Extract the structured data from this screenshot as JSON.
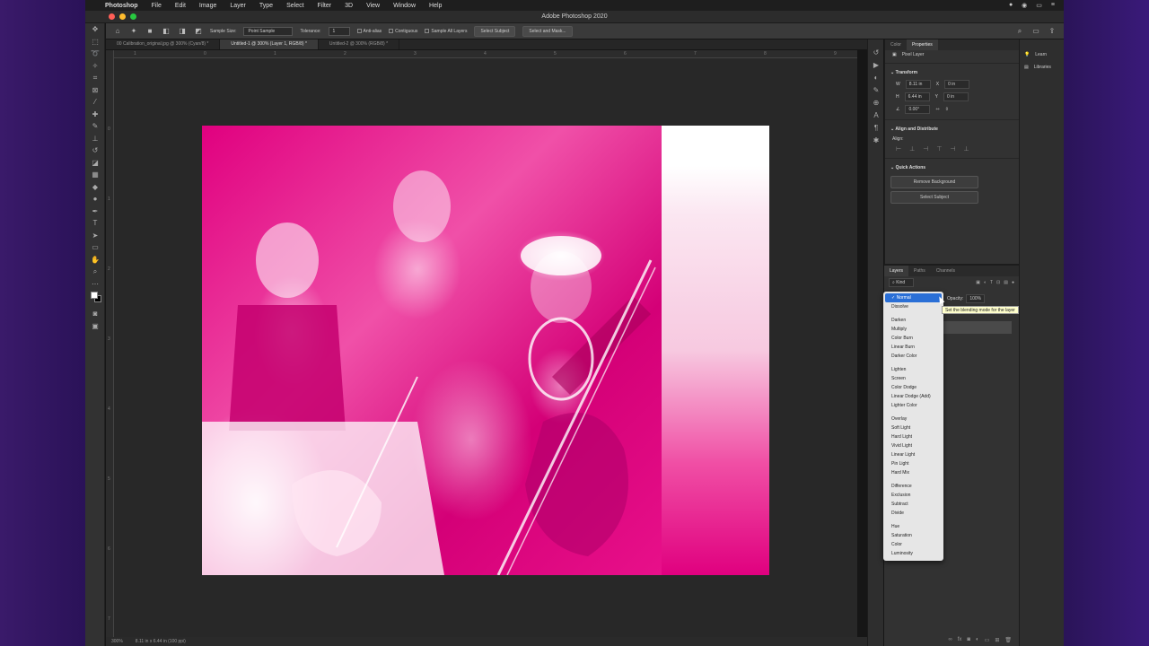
{
  "menubar": {
    "app": "Photoshop",
    "items": [
      "File",
      "Edit",
      "Image",
      "Layer",
      "Type",
      "Select",
      "Filter",
      "3D",
      "View",
      "Window",
      "Help"
    ]
  },
  "titlebar": {
    "title": "Adobe Photoshop 2020"
  },
  "options": {
    "sample_size_label": "Sample Size:",
    "sample_size_value": "Point Sample",
    "tolerance_label": "Tolerance:",
    "tolerance_value": "1",
    "anti_alias": "Anti-alias",
    "contiguous": "Contiguous",
    "sample_all": "Sample All Layers",
    "select_subject": "Select Subject",
    "select_mask": "Select and Mask..."
  },
  "tabs": [
    {
      "label": "00 Calibration_original.jpg @ 300% (Cyan/8) *"
    },
    {
      "label": "Untitled-1 @ 300% (Layer 1, RGB/8) *"
    },
    {
      "label": "Untitled-2 @ 300% (RGB/8) *"
    }
  ],
  "rulers": {
    "top": [
      "1",
      "0",
      "1",
      "2",
      "3",
      "4",
      "5",
      "6",
      "7",
      "8",
      "9"
    ],
    "left": [
      "0",
      "1",
      "2",
      "3",
      "4",
      "5",
      "6",
      "7"
    ]
  },
  "statusbar": {
    "zoom": "300%",
    "info": "8.11 in x 6.44 in (100 ppi)"
  },
  "properties": {
    "tabs": [
      "Color",
      "Properties"
    ],
    "layer_type": "Pixel Layer",
    "transform_title": "Transform",
    "w_label": "W",
    "w_value": "8.11 in",
    "x_label": "X",
    "x_value": "0 in",
    "h_label": "H",
    "h_value": "6.44 in",
    "y_label": "Y",
    "y_value": "0 in",
    "angle_value": "0.00°",
    "align_title": "Align and Distribute",
    "align_label": "Align:",
    "quick_title": "Quick Actions",
    "remove_bg": "Remove Background",
    "select_subject": "Select Subject"
  },
  "layers": {
    "tabs": [
      "Layers",
      "Paths",
      "Channels"
    ],
    "kind": "Kind",
    "opacity_label": "Opacity:",
    "opacity_value": "100%"
  },
  "dock2": {
    "learn": "Learn",
    "libraries": "Libraries"
  },
  "blend_modes": [
    [
      "Normal",
      "Dissolve"
    ],
    [
      "Darken",
      "Multiply",
      "Color Burn",
      "Linear Burn",
      "Darker Color"
    ],
    [
      "Lighten",
      "Screen",
      "Color Dodge",
      "Linear Dodge (Add)",
      "Lighter Color"
    ],
    [
      "Overlay",
      "Soft Light",
      "Hard Light",
      "Vivid Light",
      "Linear Light",
      "Pin Light",
      "Hard Mix"
    ],
    [
      "Difference",
      "Exclusion",
      "Subtract",
      "Divide"
    ],
    [
      "Hue",
      "Saturation",
      "Color",
      "Luminosity"
    ]
  ],
  "tooltip": "Set the blending mode for the layer",
  "colors": {
    "accent": "#2a6fd6",
    "magenta": "#e0007f"
  }
}
